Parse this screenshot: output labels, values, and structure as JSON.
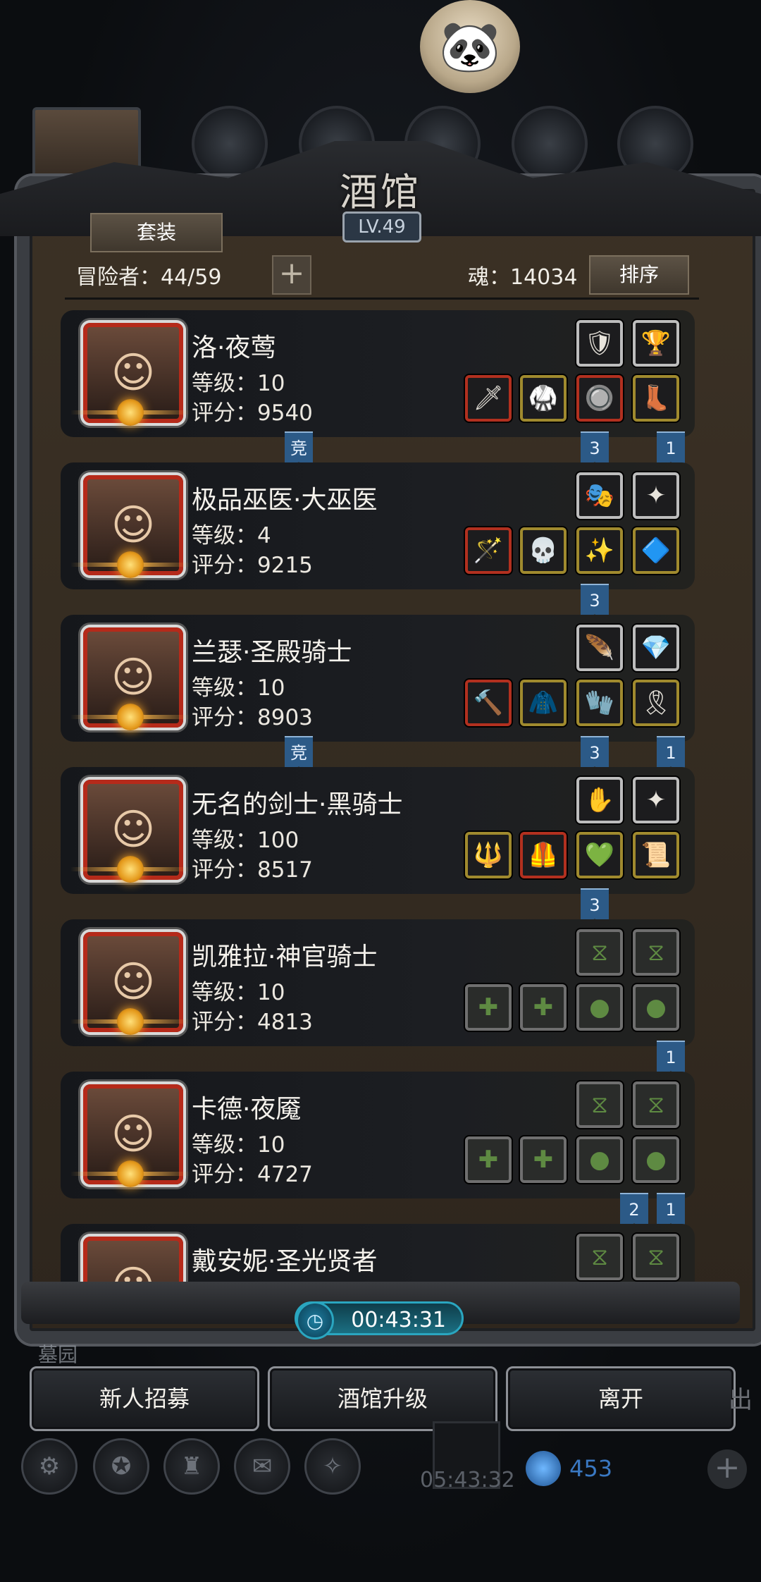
{
  "title": "酒馆",
  "level": "LV.49",
  "set_button": "套装",
  "adventurers_label": "冒险者：44/59",
  "soul_label": "魂：14034",
  "sort_button": "排序",
  "heroes": [
    {
      "name": "洛·夜莺",
      "level": "等级：10",
      "score": "评分：9540",
      "top_slots": [
        {
          "icon": "shield-icon",
          "glyph": "🛡",
          "frame": "white"
        },
        {
          "icon": "chalice-icon",
          "glyph": "🏆",
          "frame": "white"
        }
      ],
      "bottom_slots": [
        {
          "icon": "spear-icon",
          "glyph": "🗡",
          "frame": "red"
        },
        {
          "icon": "armor-icon",
          "glyph": "🥋",
          "frame": "gold"
        },
        {
          "icon": "amulet-icon",
          "glyph": "🔘",
          "frame": "red"
        },
        {
          "icon": "boots-icon",
          "glyph": "👢",
          "frame": "gold"
        }
      ],
      "tags": [
        {
          "text": "竞",
          "slot": "mid"
        },
        {
          "text": "3",
          "slot": "s3"
        },
        {
          "text": "1",
          "slot": "s4"
        }
      ]
    },
    {
      "name": "极品巫医·大巫医",
      "level": "等级：4",
      "score": "评分：9215",
      "top_slots": [
        {
          "icon": "mask-icon",
          "glyph": "🎭",
          "frame": "white"
        },
        {
          "icon": "emblem-icon",
          "glyph": "✦",
          "frame": "white"
        }
      ],
      "bottom_slots": [
        {
          "icon": "staff-icon",
          "glyph": "🪄",
          "frame": "red"
        },
        {
          "icon": "skull-armor-icon",
          "glyph": "💀",
          "frame": "gold"
        },
        {
          "icon": "orb-icon",
          "glyph": "✨",
          "frame": "gold"
        },
        {
          "icon": "rune-icon",
          "glyph": "🔷",
          "frame": "gold"
        }
      ],
      "tags": [
        {
          "text": "3",
          "slot": "s3"
        }
      ]
    },
    {
      "name": "兰瑟·圣殿骑士",
      "level": "等级：10",
      "score": "评分：8903",
      "top_slots": [
        {
          "icon": "feather-icon",
          "glyph": "🪶",
          "frame": "white"
        },
        {
          "icon": "crystal-icon",
          "glyph": "💎",
          "frame": "white"
        }
      ],
      "bottom_slots": [
        {
          "icon": "hammer-icon",
          "glyph": "🔨",
          "frame": "red"
        },
        {
          "icon": "robe-icon",
          "glyph": "🧥",
          "frame": "gold"
        },
        {
          "icon": "bracer-icon",
          "glyph": "🧤",
          "frame": "gold"
        },
        {
          "icon": "belt-icon",
          "glyph": "🎗",
          "frame": "gold"
        }
      ],
      "tags": [
        {
          "text": "竞",
          "slot": "mid"
        },
        {
          "text": "3",
          "slot": "s3"
        },
        {
          "text": "1",
          "slot": "s4"
        }
      ]
    },
    {
      "name": "无名的剑士·黑骑士",
      "level": "等级：100",
      "score": "评分：8517",
      "top_slots": [
        {
          "icon": "gauntlet-icon",
          "glyph": "✋",
          "frame": "white"
        },
        {
          "icon": "emblem-icon",
          "glyph": "✦",
          "frame": "white"
        }
      ],
      "bottom_slots": [
        {
          "icon": "wand-icon",
          "glyph": "🔱",
          "frame": "gold"
        },
        {
          "icon": "plate-armor-icon",
          "glyph": "🦺",
          "frame": "red"
        },
        {
          "icon": "gem-icon",
          "glyph": "💚",
          "frame": "gold"
        },
        {
          "icon": "scroll-icon",
          "glyph": "📜",
          "frame": "gold"
        }
      ],
      "tags": [
        {
          "text": "3",
          "slot": "s3"
        }
      ]
    },
    {
      "name": "凯雅拉·神官骑士",
      "level": "等级：10",
      "score": "评分：4813",
      "top_slots": [
        {
          "icon": "empty-slot-icon",
          "glyph": "⧖",
          "frame": "empty"
        },
        {
          "icon": "empty-slot-icon",
          "glyph": "⧖",
          "frame": "empty"
        }
      ],
      "bottom_slots": [
        {
          "icon": "empty-weapon-icon",
          "glyph": "✚",
          "frame": "empty"
        },
        {
          "icon": "empty-armor-icon",
          "glyph": "✚",
          "frame": "empty"
        },
        {
          "icon": "empty-ring-icon",
          "glyph": "●",
          "frame": "empty"
        },
        {
          "icon": "empty-ring-icon",
          "glyph": "●",
          "frame": "empty"
        }
      ],
      "tags": [
        {
          "text": "1",
          "slot": "s4"
        }
      ]
    },
    {
      "name": "卡德·夜魇",
      "level": "等级：10",
      "score": "评分：4727",
      "top_slots": [
        {
          "icon": "empty-slot-icon",
          "glyph": "⧖",
          "frame": "empty"
        },
        {
          "icon": "empty-slot-icon",
          "glyph": "⧖",
          "frame": "empty"
        }
      ],
      "bottom_slots": [
        {
          "icon": "empty-weapon-icon",
          "glyph": "✚",
          "frame": "empty"
        },
        {
          "icon": "empty-armor-icon",
          "glyph": "✚",
          "frame": "empty"
        },
        {
          "icon": "empty-ring-icon",
          "glyph": "●",
          "frame": "empty"
        },
        {
          "icon": "empty-ring-icon",
          "glyph": "●",
          "frame": "empty"
        }
      ],
      "tags": [
        {
          "text": "2",
          "slot": "s3b"
        },
        {
          "text": "1",
          "slot": "s4"
        }
      ]
    },
    {
      "name": "戴安妮·圣光贤者",
      "level": "",
      "score": "",
      "top_slots": [
        {
          "icon": "empty-slot-icon",
          "glyph": "⧖",
          "frame": "empty"
        },
        {
          "icon": "empty-slot-icon",
          "glyph": "⧖",
          "frame": "empty"
        }
      ],
      "bottom_slots": [],
      "tags": []
    }
  ],
  "timer": "00:43:31",
  "background_label": "墓园",
  "actions": {
    "recruit": "新人招募",
    "upgrade": "酒馆升级",
    "leave": "离开"
  },
  "side_text": "出",
  "dock_timer": "05:43:32",
  "gem_count": "453"
}
